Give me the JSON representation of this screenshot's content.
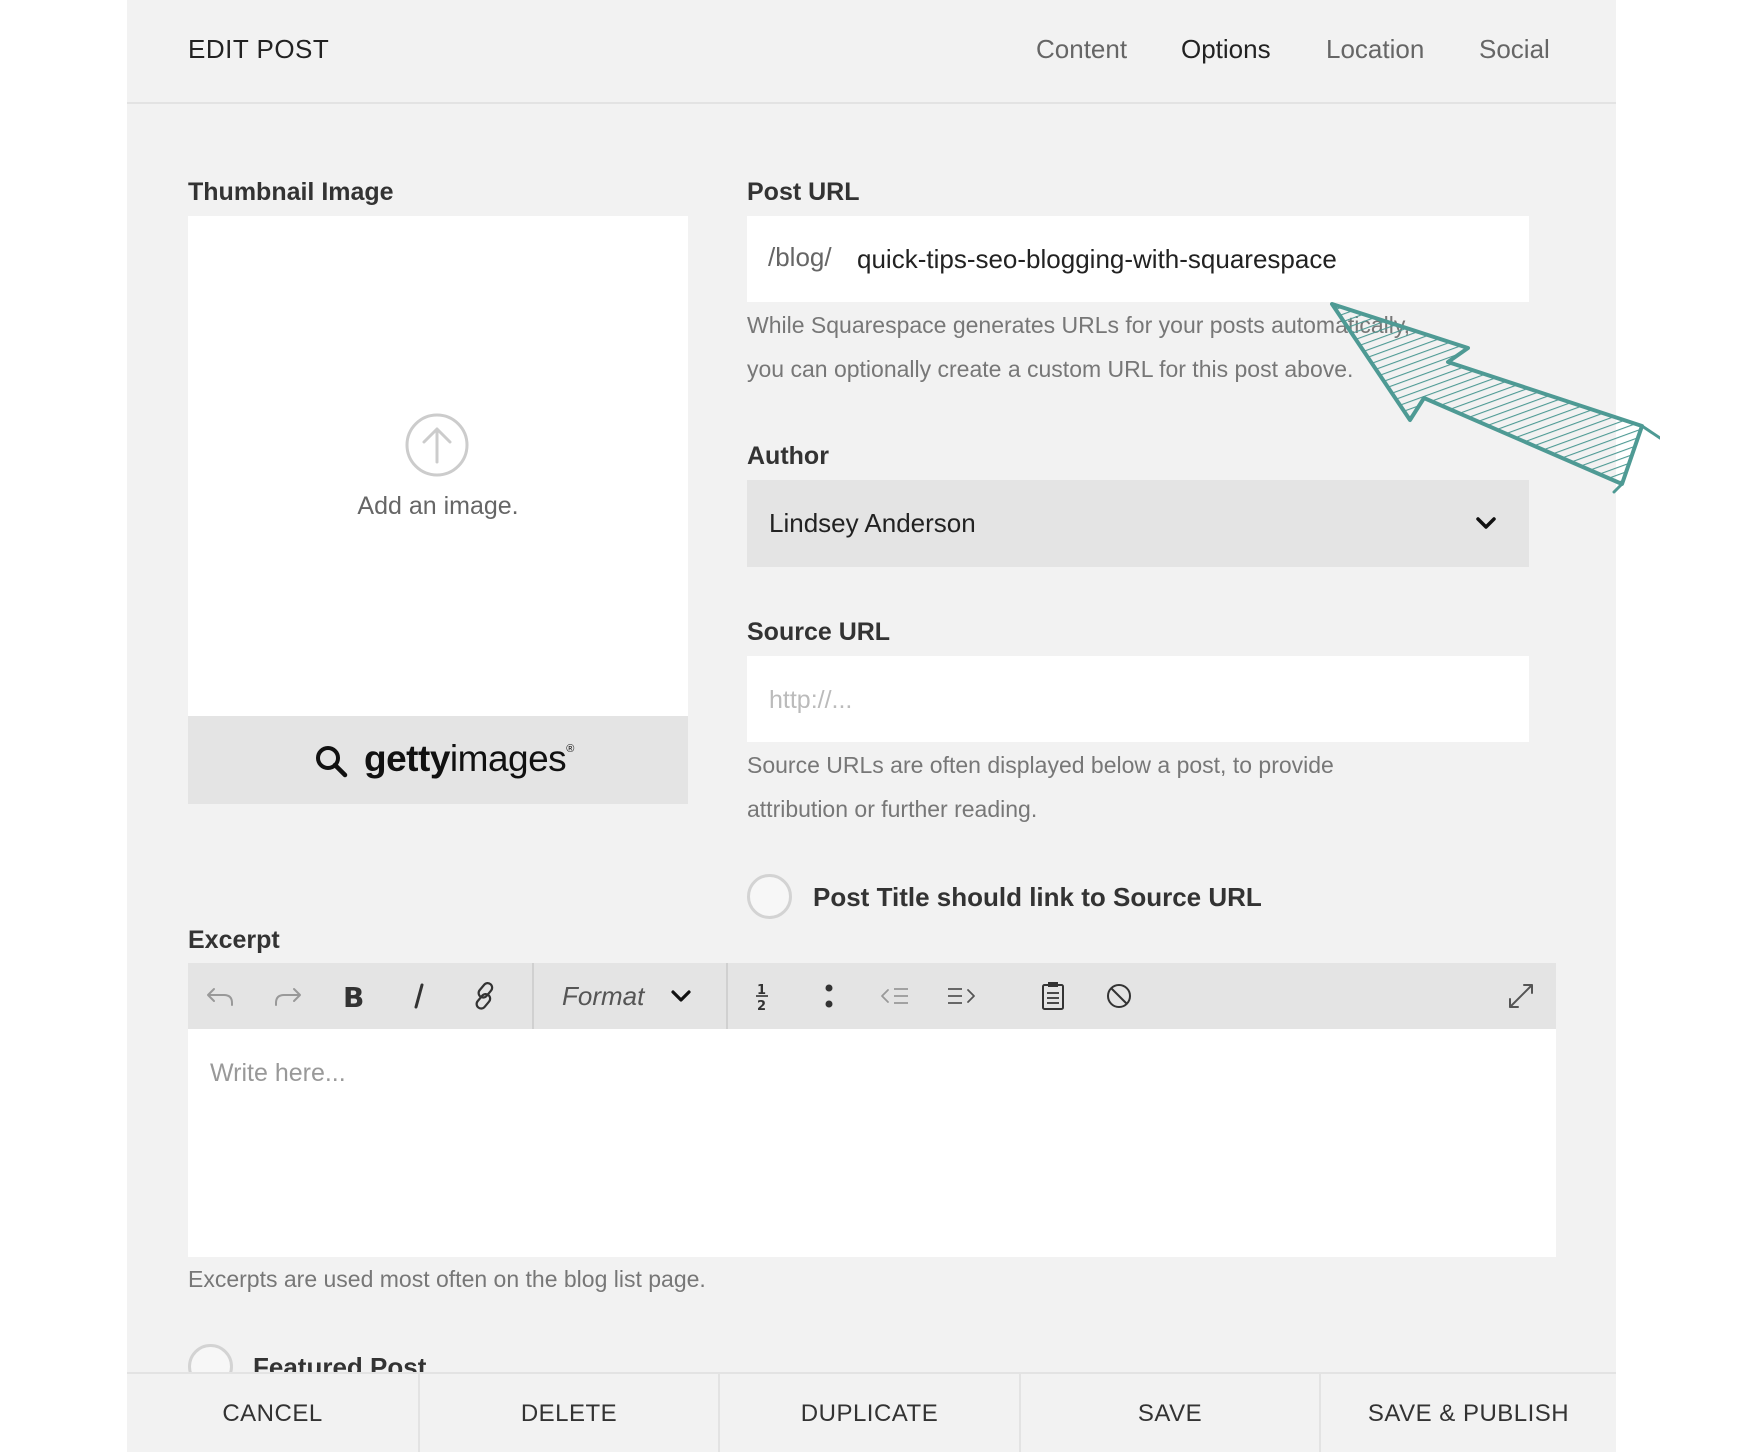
{
  "header": {
    "title": "EDIT POST",
    "tabs": [
      {
        "label": "Content",
        "active": false
      },
      {
        "label": "Options",
        "active": true
      },
      {
        "label": "Location",
        "active": false
      },
      {
        "label": "Social",
        "active": false
      }
    ]
  },
  "thumbnail": {
    "label": "Thumbnail Image",
    "add_text": "Add an image.",
    "getty": {
      "brand_bold": "getty",
      "brand_light": "images",
      "mark": "®"
    }
  },
  "post_url": {
    "label": "Post URL",
    "prefix": "/blog/",
    "value": "quick-tips-seo-blogging-with-squarespace",
    "help_line1": "While Squarespace generates URLs for your posts automatically,",
    "help_line2": "you can optionally create a custom URL for this post above."
  },
  "author": {
    "label": "Author",
    "selected": "Lindsey Anderson"
  },
  "source_url": {
    "label": "Source URL",
    "placeholder": "http://...",
    "help_line1": "Source URLs are often displayed below a post, to provide",
    "help_line2": "attribution or further reading.",
    "link_title_option": "Post Title should link to Source URL"
  },
  "excerpt": {
    "label": "Excerpt",
    "format_label": "Format",
    "placeholder": "Write here...",
    "help": "Excerpts are used most often on the blog list page."
  },
  "featured": {
    "label": "Featured Post"
  },
  "footer": {
    "buttons": [
      "CANCEL",
      "DELETE",
      "DUPLICATE",
      "SAVE",
      "SAVE & PUBLISH"
    ]
  },
  "colors": {
    "panel_bg": "#f2f2f2",
    "annotation_arrow": "#4e9a94"
  }
}
